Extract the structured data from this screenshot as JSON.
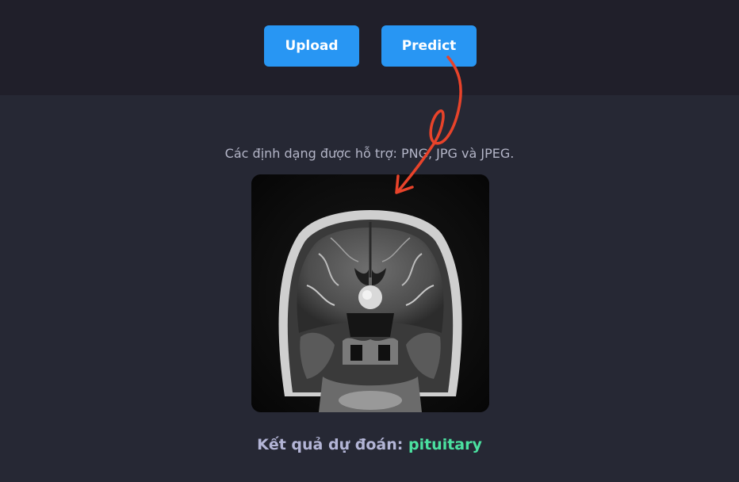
{
  "toolbar": {
    "upload_label": "Upload",
    "predict_label": "Predict"
  },
  "main": {
    "supported_formats": "Các định dạng được hỗ trợ: PNG, JPG và JPEG.",
    "result_label": "Kết quả dự đoán:",
    "result_value": "pituitary"
  },
  "colors": {
    "button": "#2896f3",
    "result_value": "#4be1a0",
    "annotation_arrow": "#e8432a"
  }
}
